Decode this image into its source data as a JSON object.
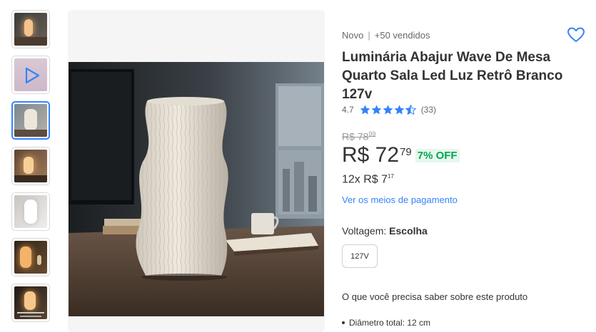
{
  "product": {
    "condition": "Novo",
    "sold": "+50 vendidos",
    "title": "Luminária Abajur Wave De Mesa Quarto Sala Led Luz Retrô Branco 127v",
    "rating_value": "4.7",
    "rating_count": "(33)",
    "rating_stars": 4.5,
    "old_price_int": "R$ 78",
    "old_price_cents": "99",
    "price_int": "R$ 72",
    "price_cents": "79",
    "discount": "7% OFF",
    "installments_text": "12x R$ 7",
    "installments_cents": "17",
    "payment_link": "Ver os meios de pagamento",
    "voltage_label": "Voltagem:",
    "voltage_value": "Escolha",
    "voltage_option": "127V",
    "specs_title": "O que você precisa saber sobre este produto",
    "specs": [
      "Diâmetro total: 12 cm"
    ]
  },
  "thumbnails": [
    {
      "kind": "image",
      "icon": "lamp-thumbnail"
    },
    {
      "kind": "video",
      "icon": "play-icon"
    },
    {
      "kind": "image",
      "icon": "lamp-thumbnail",
      "selected": true
    },
    {
      "kind": "image",
      "icon": "lamp-thumbnail"
    },
    {
      "kind": "image",
      "icon": "lamp-thumbnail"
    },
    {
      "kind": "image",
      "icon": "lamp-thumbnail"
    },
    {
      "kind": "image",
      "icon": "lamp-thumbnail"
    }
  ],
  "colors": {
    "accent": "#3483fa",
    "discount_green": "#00a650",
    "text": "#333333",
    "muted": "#666666"
  }
}
